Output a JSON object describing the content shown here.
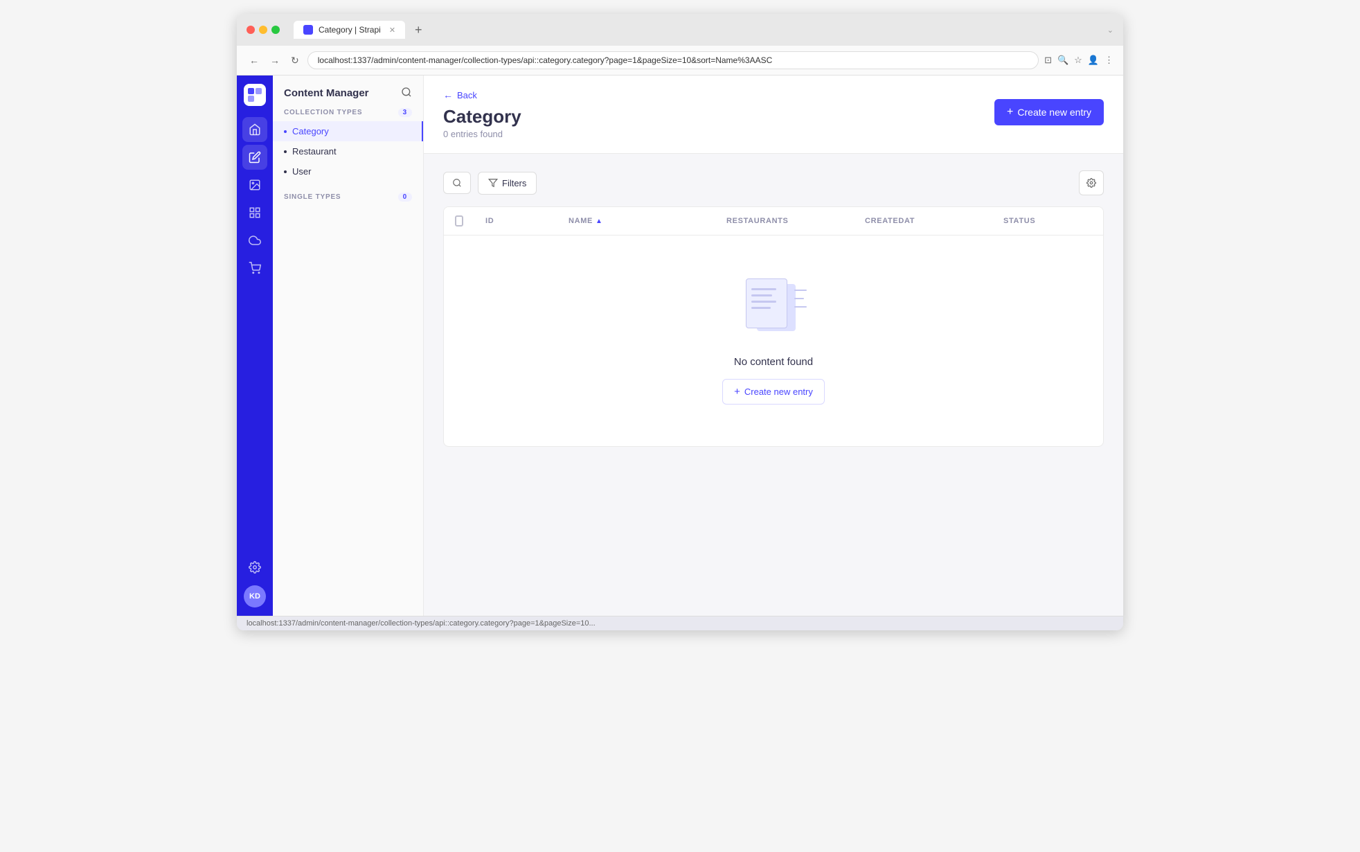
{
  "browser": {
    "tab_title": "Category | Strapi",
    "url": "localhost:1337/admin/content-manager/collection-types/api::category.category?page=1&pageSize=10&sort=Name%3AASC",
    "nav_back": "←",
    "nav_forward": "→",
    "nav_refresh": "↻",
    "new_tab": "+",
    "status_bar_text": "localhost:1337/admin/content-manager/collection-types/api::category.category?page=1&pageSize=10..."
  },
  "sidebar": {
    "app_title": "Content Manager",
    "collection_types_label": "COLLECTION TYPES",
    "collection_types_count": "3",
    "collection_items": [
      {
        "id": "category",
        "label": "Category",
        "active": true
      },
      {
        "id": "restaurant",
        "label": "Restaurant",
        "active": false
      },
      {
        "id": "user",
        "label": "User",
        "active": false
      }
    ],
    "single_types_label": "SINGLE TYPES",
    "single_types_count": "0"
  },
  "main": {
    "back_label": "Back",
    "page_title": "Category",
    "entries_count": "0 entries found",
    "create_btn_label": "Create new entry",
    "toolbar": {
      "filter_label": "Filters"
    },
    "table": {
      "columns": [
        "ID",
        "NAME",
        "RESTAURANTS",
        "CREATEDAT",
        "STATUS"
      ]
    },
    "empty_state": {
      "title": "No content found",
      "create_btn_label": "Create new entry"
    }
  },
  "rail_icons": {
    "home": "⌂",
    "content": "✦",
    "media": "⬜",
    "layout": "▦",
    "plugins": "☁",
    "shop": "🛒",
    "settings": "⚙"
  },
  "user": {
    "initials": "KD"
  },
  "colors": {
    "brand": "#4945ff",
    "rail_bg": "#271fe0",
    "text_dark": "#32324d",
    "text_muted": "#8e8ea9",
    "border": "#eaeaea",
    "empty_doc": "#dde0ff",
    "empty_doc2": "#eceeff"
  }
}
